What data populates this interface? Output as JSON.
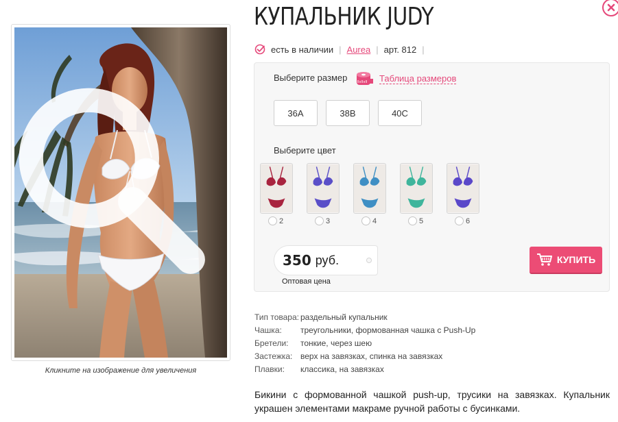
{
  "product": {
    "title": "КУПАЛЬНИК JUDY",
    "availability": "есть в наличии",
    "brand": "Aurea",
    "article": "арт. 812"
  },
  "image": {
    "caption": "Кликните на изображение для увеличения"
  },
  "options": {
    "size_label": "Выберите размер",
    "size_chart_link": "Таблица размеров",
    "sizes": [
      "36A",
      "38B",
      "40C"
    ],
    "color_label": "Выберите цвет",
    "colors": [
      {
        "number": "2",
        "color": "#a8243f"
      },
      {
        "number": "3",
        "color": "#5a4fc8"
      },
      {
        "number": "4",
        "color": "#3f8fc4"
      },
      {
        "number": "5",
        "color": "#3fb59c"
      },
      {
        "number": "6",
        "color": "#5a48c9"
      }
    ]
  },
  "price": {
    "amount": "350",
    "currency": "руб.",
    "note": "Оптовая цена"
  },
  "buy_button": {
    "label": "КУПИТЬ"
  },
  "specs": [
    {
      "key": "Тип товара:",
      "value": "раздельный купальник"
    },
    {
      "key": "Чашка:",
      "value": "треугольники, формованная чашка с Push-Up"
    },
    {
      "key": "Бретели:",
      "value": "тонкие, через шею"
    },
    {
      "key": "Застежка:",
      "value": "верх на завязках, спинка на завязках"
    },
    {
      "key": "Плавки:",
      "value": "классика, на завязках"
    }
  ],
  "description": "Бикини с формованной чашкой push-up, трусики на завязках. Купальник украшен элементами макраме ручной работы с бусинками.",
  "icons": {
    "availability": "check-circle-icon",
    "size_chart": "measuring-tape-icon",
    "zoom": "magnifier-icon",
    "cart": "cart-icon",
    "close": "close-icon"
  },
  "colors_theme": {
    "accent": "#e5487a",
    "buy": "#ec4c75"
  }
}
